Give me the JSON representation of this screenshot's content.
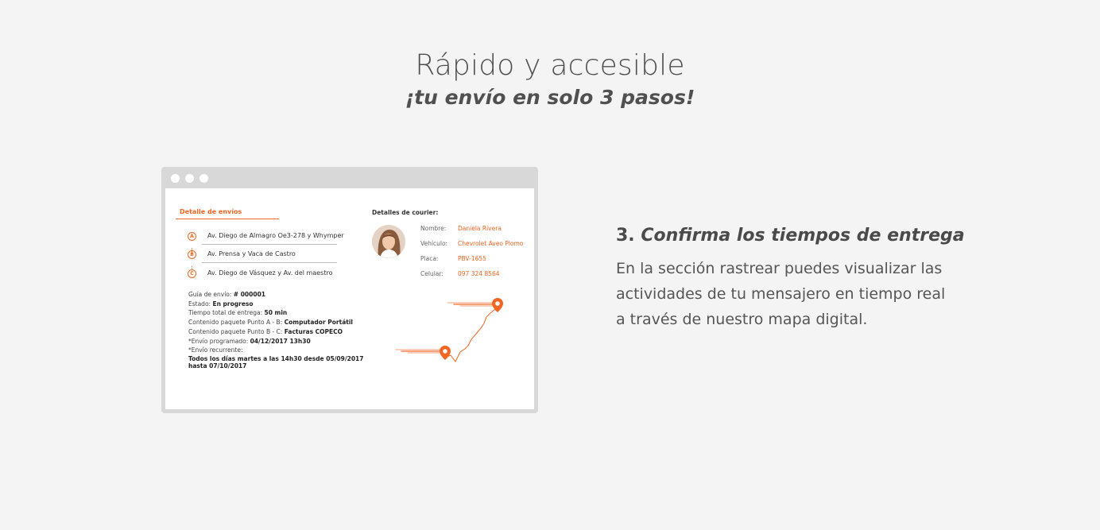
{
  "hero": {
    "title": "Rápido y accesible",
    "subtitle": "¡tu envío en solo 3 pasos!"
  },
  "mockup": {
    "tab_title": "Detalle de envíos",
    "route": [
      {
        "marker": "A",
        "address": "Av. Diego de Almagro Oe3-278 y Whymper"
      },
      {
        "marker": "B",
        "address": "Av. Prensa y Vaca de Castro"
      },
      {
        "marker": "C",
        "address": "Av. Diego de Vásquez y Av. del maestro"
      }
    ],
    "info": {
      "guide_label": "Guía de envío:",
      "guide_value": "# 000001",
      "status_label": "Estado:",
      "status_value": "En progreso",
      "time_label": "Tiempo total de entrega:",
      "time_value": "50 min",
      "content_ab_label": "Contenido paquete Punto A - B:",
      "content_ab_value": "Computador Portátil",
      "content_bc_label": "Contenido paquete Punto B - C:",
      "content_bc_value": "Facturas COPECO",
      "scheduled_label": "*Envío programado:",
      "scheduled_value": "04/12/2017 13h30",
      "recurring_label": "*Envío recurrente:",
      "recurring_value_1": "Todos los días martes a las 14h30 desde 05/09/2017",
      "recurring_value_2": "hasta 07/10/2017"
    },
    "courier": {
      "title": "Detalles de courier:",
      "rows": [
        {
          "label": "Nombre:",
          "value": "Daniela Rivera"
        },
        {
          "label": "Vehículo:",
          "value": "Chevrolet Aveo Plomo"
        },
        {
          "label": "Placa:",
          "value": "PBV-1655"
        },
        {
          "label": "Celular:",
          "value": "097 324 8564"
        }
      ]
    },
    "accent_color": "#f26522"
  },
  "step": {
    "number": "3.",
    "title": "Confirma los tiempos de entrega",
    "description": "En la sección rastrear puedes visualizar las actividades de tu mensajero en tiempo real a través de nuestro mapa digital."
  }
}
